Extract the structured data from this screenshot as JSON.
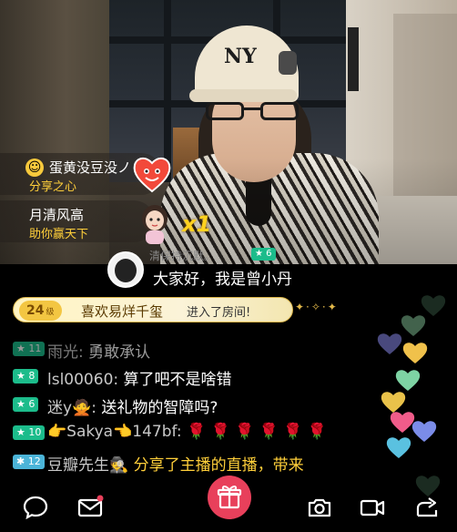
{
  "gifts": [
    {
      "avatar": "smiley-avatar",
      "name": "蛋黄没豆没ノ",
      "desc": "分享之心",
      "icon": "heart-gift-icon"
    },
    {
      "name": "月清风高",
      "desc": "助你赢天下",
      "icon": "doll-gift-icon",
      "count": "x1"
    }
  ],
  "host_message": {
    "name": "清保持沉默。",
    "level": "★ 6",
    "text": "大家好，我是曾小丹"
  },
  "enter_banner": {
    "level": "24",
    "level_unit": "级",
    "name": "喜欢易烊千玺",
    "text": "进入了房间!",
    "sparkle": "✦·✧·✦"
  },
  "chat": [
    {
      "badge": "★ 11",
      "badge_color": "#1cbc8b",
      "user": "雨光:",
      "content": "勇敢承认"
    },
    {
      "badge": "★ 8",
      "badge_color": "#1cbc8b",
      "user": "lsl00060:",
      "content": "算了吧不是啥错"
    },
    {
      "badge": "★ 6",
      "badge_color": "#1cbc8b",
      "user": "迷y🙅:",
      "content": "送礼物的智障吗?"
    },
    {
      "badge": "★ 10",
      "badge_color": "#1cbc8b",
      "user": "👉Sakya👈147bf:",
      "content": "🌹 🌹 🌹 🌹 🌹 🌹"
    },
    {
      "badge": "✱ 12",
      "badge_color": "#4bb4d8",
      "user": "豆瓣先生🕵",
      "content": "分享了主播的直播，带来"
    }
  ],
  "toolbar": [
    {
      "icon": "chat-bubble-icon"
    },
    {
      "icon": "mail-icon",
      "notification": true
    },
    {
      "icon": "gift-icon"
    },
    {
      "icon": "camera-icon"
    },
    {
      "icon": "video-record-icon"
    },
    {
      "icon": "share-icon"
    }
  ],
  "colors": {
    "gift_desc": "#ffcf3a",
    "level_badge_green": "#1cbc8b",
    "level_badge_blue": "#4bb4d8",
    "gift_button": "#e8405b",
    "enter_banner_bg": "#fff4c2"
  }
}
